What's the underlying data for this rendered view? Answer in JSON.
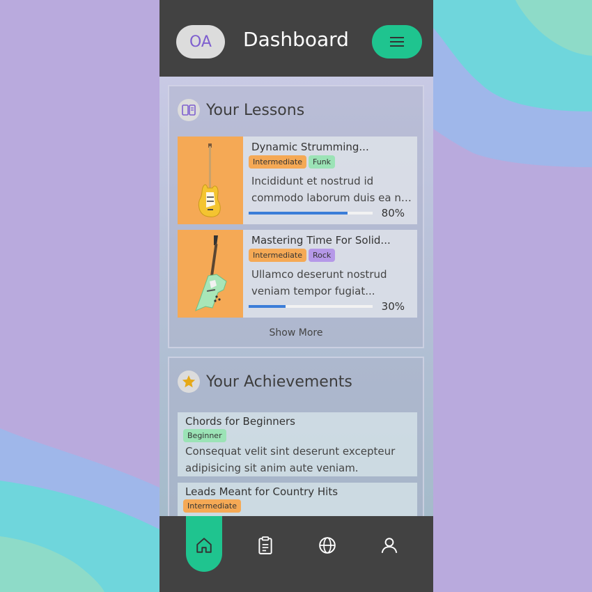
{
  "header": {
    "avatar_initials": "OA",
    "title": "Dashboard",
    "menu_icon": "hamburger-icon"
  },
  "lessons_section": {
    "title": "Your Lessons",
    "icon": "book-icon",
    "items": [
      {
        "title": "Dynamic Strumming...",
        "tags": [
          "Intermediate",
          "Funk"
        ],
        "description_line1": "Incididunt et nostrud id",
        "description_line2": "commodo laborum duis ea nisi...",
        "progress": 0.8,
        "progress_label": "80%",
        "image": "electric-guitar-yellow"
      },
      {
        "title": "Mastering Time For Solid...",
        "tags": [
          "Intermediate",
          "Rock"
        ],
        "description_line1": "Ullamco deserunt nostrud",
        "description_line2": "veniam tempor fugiat...",
        "progress": 0.3,
        "progress_label": "30%",
        "image": "electric-guitar-explorer-green"
      }
    ],
    "show_more_label": "Show More"
  },
  "achievements_section": {
    "title": "Your Achievements",
    "icon": "star-icon",
    "items": [
      {
        "title": "Chords for Beginners",
        "tag": "Beginner",
        "description_line1": "Consequat velit sint deserunt excepteur",
        "description_line2": "adipisicing sit anim aute veniam."
      },
      {
        "title": "Leads Meant for Country Hits",
        "tag": "Intermediate"
      }
    ]
  },
  "bottom_nav": {
    "items": [
      "home-icon",
      "clipboard-icon",
      "globe-icon",
      "user-icon"
    ],
    "active": "home-icon"
  },
  "colors": {
    "accent": "#1fc48f",
    "bar": "#424242",
    "intermediate_tag": "#f5a955",
    "funk_tag": "#9be3b6",
    "rock_tag": "#b598e8",
    "beginner_tag": "#9be3b6",
    "progress": "#3b7dd8",
    "lesson_thumb_bg": "#f5a955"
  }
}
